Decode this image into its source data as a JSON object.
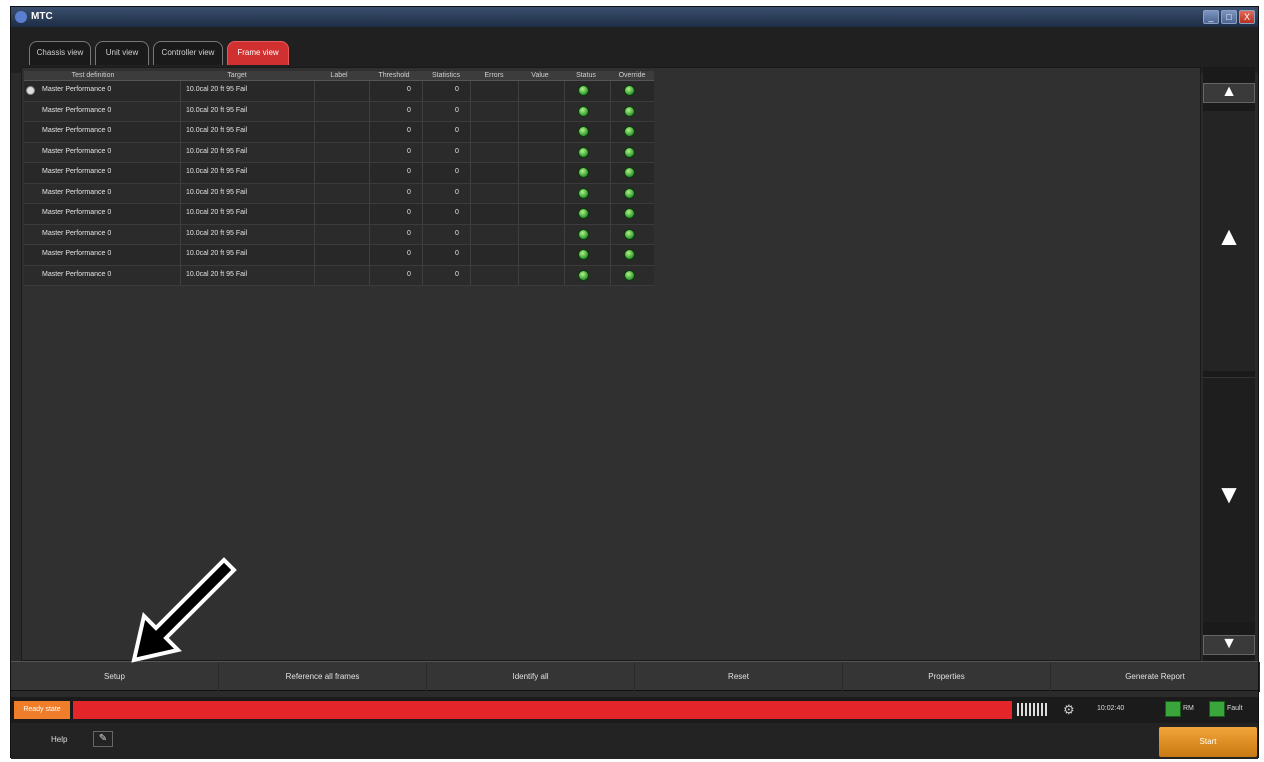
{
  "window": {
    "title": "MTC",
    "controls": [
      "_",
      "□",
      "X"
    ]
  },
  "tabs": [
    {
      "label": "Chassis view"
    },
    {
      "label": "Unit view"
    },
    {
      "label": "Controller view"
    },
    {
      "label": "Frame view"
    }
  ],
  "grid": {
    "columns": [
      "Test definition",
      "Target",
      "Label",
      "Threshold",
      "Statistics",
      "Errors",
      "Value",
      "Status",
      "Override"
    ],
    "rows": [
      {
        "name": "Master Performance 0",
        "target": "10.0cal 20 ft 95 Fail",
        "v1": "0",
        "v2": "0"
      },
      {
        "name": "Master Performance 0",
        "target": "10.0cal 20 ft 95 Fail",
        "v1": "0",
        "v2": "0"
      },
      {
        "name": "Master Performance 0",
        "target": "10.0cal 20 ft 95 Fail",
        "v1": "0",
        "v2": "0"
      },
      {
        "name": "Master Performance 0",
        "target": "10.0cal 20 ft 95 Fail",
        "v1": "0",
        "v2": "0"
      },
      {
        "name": "Master Performance 0",
        "target": "10.0cal 20 ft 95 Fail",
        "v1": "0",
        "v2": "0"
      },
      {
        "name": "Master Performance 0",
        "target": "10.0cal 20 ft 95 Fail",
        "v1": "0",
        "v2": "0"
      },
      {
        "name": "Master Performance 0",
        "target": "10.0cal 20 ft 95 Fail",
        "v1": "0",
        "v2": "0"
      },
      {
        "name": "Master Performance 0",
        "target": "10.0cal 20 ft 95 Fail",
        "v1": "0",
        "v2": "0"
      },
      {
        "name": "Master Performance 0",
        "target": "10.0cal 20 ft 95 Fail",
        "v1": "0",
        "v2": "0"
      },
      {
        "name": "Master Performance 0",
        "target": "10.0cal 20 ft 95 Fail",
        "v1": "0",
        "v2": "0"
      }
    ]
  },
  "actions": [
    {
      "label": "Setup"
    },
    {
      "label": "Reference all frames"
    },
    {
      "label": "Identify all"
    },
    {
      "label": "Reset"
    },
    {
      "label": "Properties"
    },
    {
      "label": "Generate Report"
    }
  ],
  "status": {
    "chip": "Ready state",
    "clock": "10:02:40",
    "led1": "RM",
    "led2": "Fault"
  },
  "bottom": {
    "help": "Help",
    "start": "Start"
  },
  "colors": {
    "accent": "#e4262a",
    "ok": "#3aa53a",
    "warning": "#ef7d2a"
  }
}
